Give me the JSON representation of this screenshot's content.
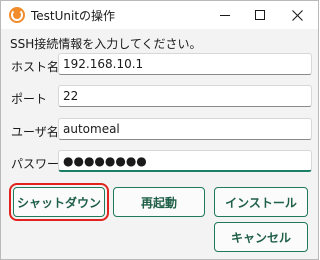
{
  "window": {
    "title": "TestUnitの操作",
    "icon": "app-icon"
  },
  "instruction": "SSH接続情報を入力してください。",
  "fields": {
    "host": {
      "label": "ホスト名",
      "value": "192.168.10.1"
    },
    "port": {
      "label": "ポート",
      "value": "22"
    },
    "user": {
      "label": "ユーザ名",
      "value": "automeal"
    },
    "password": {
      "label": "パスワード",
      "value": "●●●●●●●●"
    }
  },
  "buttons": {
    "shutdown": "シャットダウン",
    "restart": "再起動",
    "install": "インストール",
    "cancel": "キャンセル"
  },
  "colors": {
    "accent": "#1f7a5c",
    "highlight": "#e0231c"
  }
}
